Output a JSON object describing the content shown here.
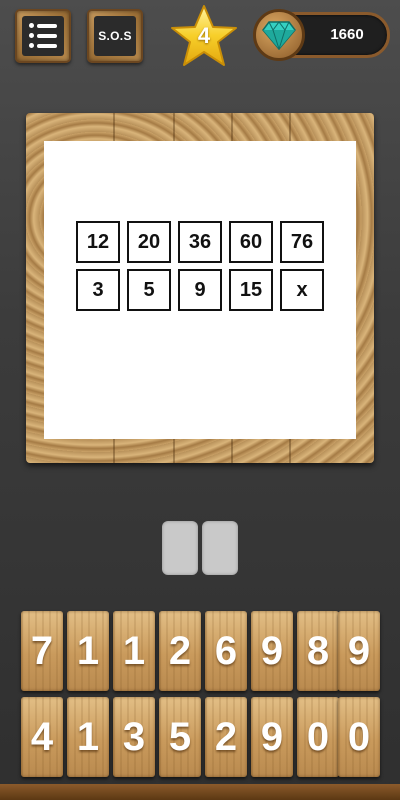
{
  "header": {
    "menu_icon": "list-menu-icon",
    "sos_label": "S.O.S",
    "level": "4",
    "level_icon": "star-icon",
    "gems": "1660",
    "gem_icon": "diamond-icon"
  },
  "puzzle": {
    "top_row": [
      "12",
      "20",
      "36",
      "60",
      "76"
    ],
    "bottom_row": [
      "3",
      "5",
      "9",
      "15",
      "x"
    ]
  },
  "answer": {
    "slots": [
      "",
      ""
    ]
  },
  "keypad": {
    "row1": [
      "7",
      "1",
      "1",
      "2",
      "6",
      "9",
      "8",
      "9"
    ],
    "row2": [
      "4",
      "1",
      "3",
      "5",
      "2",
      "9",
      "0",
      "0"
    ]
  },
  "colors": {
    "background": "#3c3c3c",
    "wood": "#c99a5c",
    "star": "#f5c518",
    "gem": "#2ec4b6"
  }
}
